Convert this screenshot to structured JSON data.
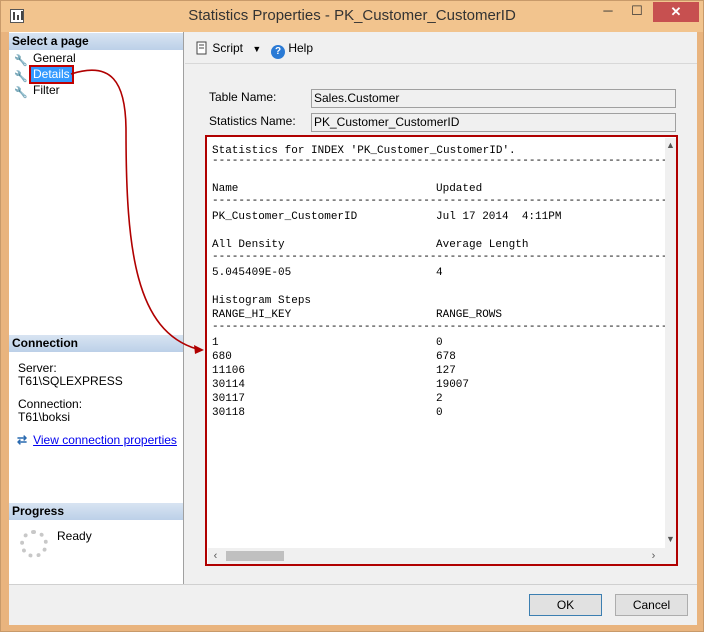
{
  "window": {
    "title": "Statistics Properties - PK_Customer_CustomerID",
    "minimize_glyph": "─",
    "maximize_glyph": "☐",
    "close_glyph": "✕"
  },
  "sidebar": {
    "select_page_header": "Select a page",
    "pages": [
      {
        "label": "General",
        "icon": "wrench-icon"
      },
      {
        "label": "Details",
        "icon": "wrench-icon",
        "selected": true
      },
      {
        "label": "Filter",
        "icon": "wrench-icon"
      }
    ],
    "connection_header": "Connection",
    "server_label": "Server:",
    "server_value": "T61\\SQLEXPRESS",
    "connection_label": "Connection:",
    "connection_value": "T61\\boksi",
    "view_connection_link": "View connection properties",
    "progress_header": "Progress",
    "progress_status": "Ready"
  },
  "toolbar": {
    "script_label": "Script",
    "help_label": "Help"
  },
  "form": {
    "table_name_label": "Table Name:",
    "table_name_value": "Sales.Customer",
    "statistics_name_label": "Statistics Name:",
    "statistics_name_value": "PK_Customer_CustomerID"
  },
  "details": {
    "heading": "Statistics for INDEX 'PK_Customer_CustomerID'.",
    "col_name": "Name",
    "col_updated": "Updated",
    "name_value": "PK_Customer_CustomerID",
    "updated_value": "Jul 17 2014  4:11PM",
    "col_all_density": "All Density",
    "col_average_length": "Average Length",
    "all_density_value": "5.045409E-05",
    "average_length_value": "4",
    "histogram_title": "Histogram Steps",
    "col_range_hi_key": "RANGE_HI_KEY",
    "col_range_rows": "RANGE_ROWS",
    "histogram_rows": [
      {
        "key": "1",
        "rows": "0"
      },
      {
        "key": "680",
        "rows": "678"
      },
      {
        "key": "11106",
        "rows": "127"
      },
      {
        "key": "30114",
        "rows": "19007"
      },
      {
        "key": "30117",
        "rows": "2"
      },
      {
        "key": "30118",
        "rows": "0"
      }
    ]
  },
  "buttons": {
    "ok": "OK",
    "cancel": "Cancel"
  },
  "colors": {
    "annotation": "#b00000",
    "selection": "#3399ff",
    "title_bar": "#f2c48e"
  }
}
